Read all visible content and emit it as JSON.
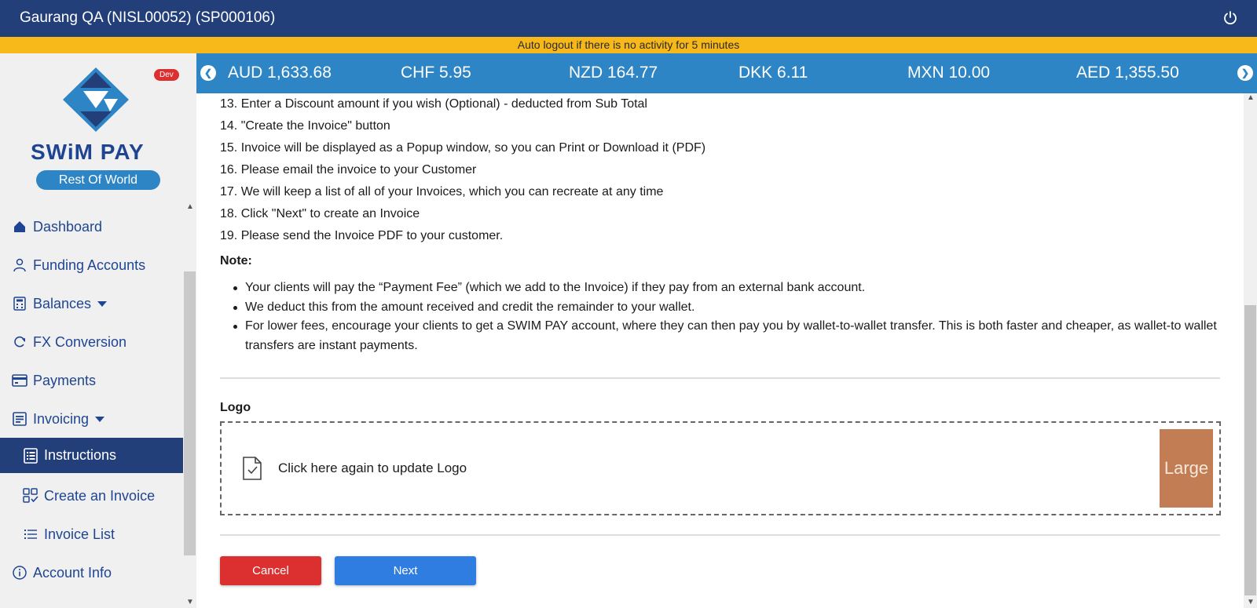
{
  "header": {
    "title": "Gaurang QA (NISL00052) (SP000106)",
    "power_icon": "power-icon"
  },
  "notice": {
    "text": "Auto logout if there is no activity for 5 minutes"
  },
  "sidebar": {
    "dev_badge": "Dev",
    "brand": "SWiM PAY",
    "region": "Rest Of World",
    "items": [
      {
        "label": "Dashboard",
        "icon": "home-icon"
      },
      {
        "label": "Funding Accounts",
        "icon": "user-icon"
      },
      {
        "label": "Balances",
        "icon": "calculator-icon"
      },
      {
        "label": "FX Conversion",
        "icon": "refresh-icon"
      },
      {
        "label": "Payments",
        "icon": "card-icon"
      },
      {
        "label": "Invoicing",
        "icon": "invoice-icon"
      },
      {
        "label": "Instructions",
        "icon": "document-list-icon"
      },
      {
        "label": "Create an Invoice",
        "icon": "grid-check-icon"
      },
      {
        "label": "Invoice List",
        "icon": "list-icon"
      },
      {
        "label": "Account Info",
        "icon": "info-icon"
      }
    ]
  },
  "ticker": {
    "items": [
      "AUD 1,633.68",
      "CHF 5.95",
      "NZD 164.77",
      "DKK 6.11",
      "MXN 10.00",
      "AED 1,355.50"
    ]
  },
  "content": {
    "steps": [
      "13. Enter a Discount amount if you wish (Optional) - deducted from Sub Total",
      "14. \"Create the Invoice\" button",
      "15. Invoice will be displayed as a Popup window, so you can Print or Download it (PDF)",
      "16. Please email the invoice to your Customer",
      "17. We will keep a list of all of your Invoices, which you can recreate at any time",
      "18. Click \"Next\" to create an Invoice",
      "19. Please send the Invoice PDF to your customer."
    ],
    "note_label": "Note:",
    "notes": [
      "Your clients will pay the “Payment Fee” (which we add to the Invoice) if they pay from an external bank account.",
      "We deduct this from the amount received and credit the remainder to your wallet.",
      "For lower fees, encourage your clients to get a SWIM PAY account, where they can then pay you by wallet-to-wallet transfer. This is both faster and cheaper, as wallet-to wallet transfers are instant payments."
    ],
    "logo_label": "Logo",
    "logo_upload_text": "Click here again to update Logo",
    "logo_preview_text": "Large",
    "cancel_label": "Cancel",
    "next_label": "Next"
  },
  "colors": {
    "header": "#233f7a",
    "notice": "#f7b81a",
    "ticker": "#2d85c5",
    "cancel": "#dc2f2f",
    "next": "#2f7de0"
  }
}
